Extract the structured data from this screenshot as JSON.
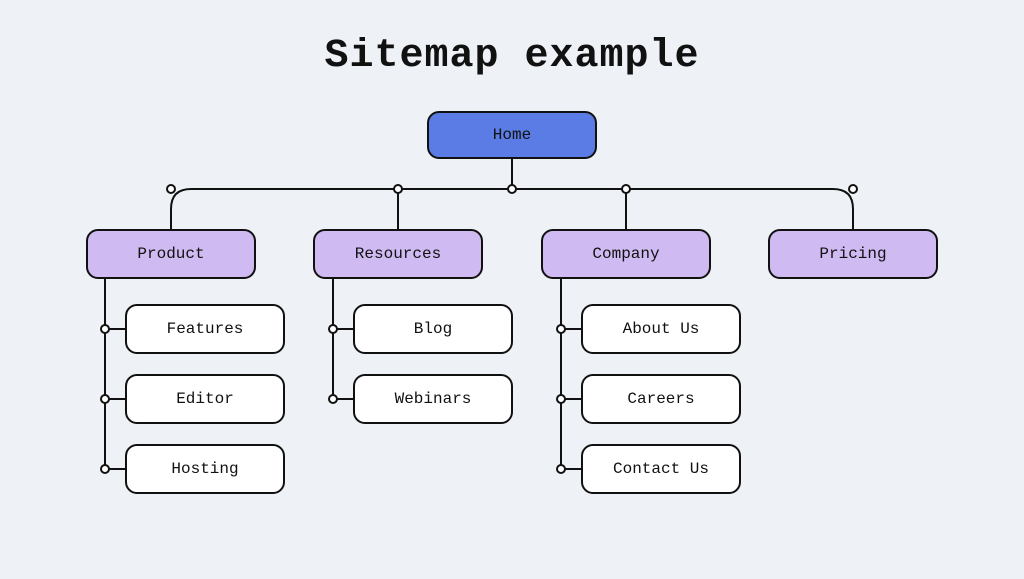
{
  "title": "Sitemap example",
  "nodes": {
    "home": "Home",
    "product": "Product",
    "resources": "Resources",
    "company": "Company",
    "pricing": "Pricing",
    "features": "Features",
    "editor": "Editor",
    "hosting": "Hosting",
    "blog": "Blog",
    "webinars": "Webinars",
    "about_us": "About Us",
    "careers": "Careers",
    "contact_us": "Contact Us"
  },
  "colors": {
    "bg": "#eef1f6",
    "root": "#5a7ce4",
    "section": "#cfbaf2",
    "leaf": "#ffffff",
    "stroke": "#111111"
  }
}
